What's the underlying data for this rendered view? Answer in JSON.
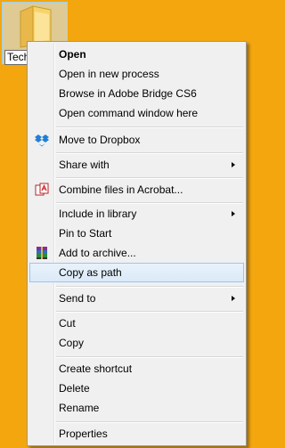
{
  "desktop": {
    "folder_label": "Tech",
    "folder_icon": "folder-icon"
  },
  "menu": {
    "items": [
      {
        "label": "Open",
        "bold": true
      },
      {
        "label": "Open in new process"
      },
      {
        "label": "Browse in Adobe Bridge CS6"
      },
      {
        "label": "Open command window here"
      },
      {
        "label": "Move to Dropbox",
        "icon": "dropbox-icon"
      },
      {
        "label": "Share with",
        "submenu": true
      },
      {
        "label": "Combine files in Acrobat...",
        "icon": "acrobat-icon"
      },
      {
        "label": "Include in library",
        "submenu": true
      },
      {
        "label": "Pin to Start"
      },
      {
        "label": "Add to archive...",
        "icon": "winrar-icon"
      },
      {
        "label": "Copy as path",
        "highlighted": true
      },
      {
        "label": "Send to",
        "submenu": true
      },
      {
        "label": "Cut"
      },
      {
        "label": "Copy"
      },
      {
        "label": "Create shortcut"
      },
      {
        "label": "Delete"
      },
      {
        "label": "Rename"
      },
      {
        "label": "Properties"
      }
    ]
  },
  "colors": {
    "desktop_background": "#f4a60f",
    "menu_background": "#f0f0f0",
    "highlight_border": "#99c6ee"
  }
}
